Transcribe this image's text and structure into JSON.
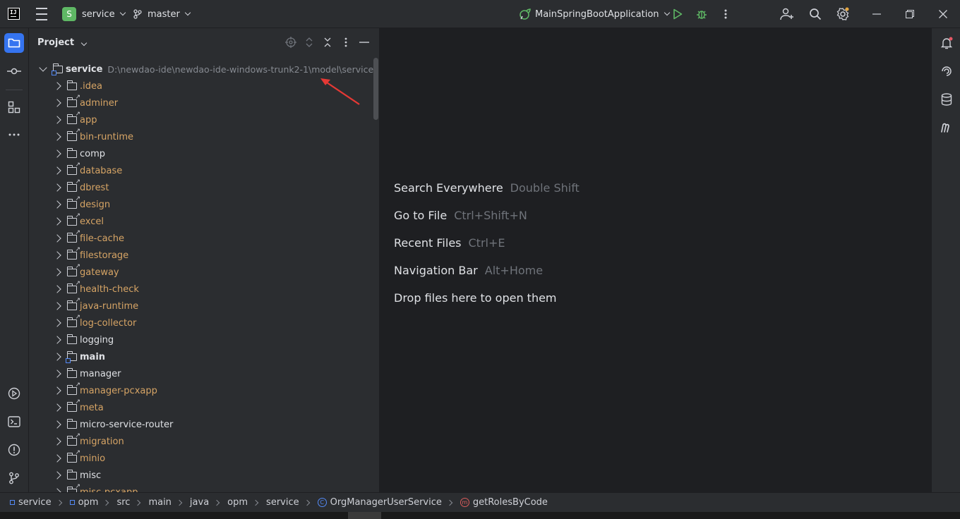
{
  "titlebar": {
    "project_letter": "S",
    "project_name": "service",
    "branch": "master",
    "run_config": "MainSpringBootApplication"
  },
  "project_panel": {
    "title": "Project",
    "root": {
      "name": "service",
      "path": "D:\\newdao-ide\\newdao-ide-windows-trunk2-1\\model\\service"
    },
    "items": [
      {
        "name": ".idea",
        "style": "orange",
        "icon": "folder"
      },
      {
        "name": "adminer",
        "style": "orange",
        "icon": "folder-ext"
      },
      {
        "name": "app",
        "style": "orange",
        "icon": "folder-ext"
      },
      {
        "name": "bin-runtime",
        "style": "orange",
        "icon": "folder-ext"
      },
      {
        "name": "comp",
        "style": "normal",
        "icon": "folder"
      },
      {
        "name": "database",
        "style": "orange",
        "icon": "folder-ext"
      },
      {
        "name": "dbrest",
        "style": "orange",
        "icon": "folder-ext"
      },
      {
        "name": "design",
        "style": "orange",
        "icon": "folder-ext"
      },
      {
        "name": "excel",
        "style": "orange",
        "icon": "folder-ext"
      },
      {
        "name": "file-cache",
        "style": "orange",
        "icon": "folder-ext"
      },
      {
        "name": "filestorage",
        "style": "orange",
        "icon": "folder-ext"
      },
      {
        "name": "gateway",
        "style": "orange",
        "icon": "folder-ext"
      },
      {
        "name": "health-check",
        "style": "orange",
        "icon": "folder-ext"
      },
      {
        "name": "java-runtime",
        "style": "orange",
        "icon": "folder-ext"
      },
      {
        "name": "log-collector",
        "style": "orange",
        "icon": "folder-ext"
      },
      {
        "name": "logging",
        "style": "normal",
        "icon": "folder"
      },
      {
        "name": "main",
        "style": "bold",
        "icon": "folder-module"
      },
      {
        "name": "manager",
        "style": "normal",
        "icon": "folder"
      },
      {
        "name": "manager-pcxapp",
        "style": "orange",
        "icon": "folder-ext"
      },
      {
        "name": "meta",
        "style": "orange",
        "icon": "folder-ext"
      },
      {
        "name": "micro-service-router",
        "style": "normal",
        "icon": "folder"
      },
      {
        "name": "migration",
        "style": "orange",
        "icon": "folder-ext"
      },
      {
        "name": "minio",
        "style": "orange",
        "icon": "folder-ext"
      },
      {
        "name": "misc",
        "style": "normal",
        "icon": "folder"
      },
      {
        "name": "misc-pcxapp",
        "style": "orange",
        "icon": "folder-ext"
      }
    ]
  },
  "editor_hints": [
    {
      "action": "Search Everywhere",
      "shortcut": "Double Shift"
    },
    {
      "action": "Go to File",
      "shortcut": "Ctrl+Shift+N"
    },
    {
      "action": "Recent Files",
      "shortcut": "Ctrl+E"
    },
    {
      "action": "Navigation Bar",
      "shortcut": "Alt+Home"
    },
    {
      "action": "Drop files here to open them",
      "shortcut": ""
    }
  ],
  "statusbar": {
    "breadcrumbs": [
      "service",
      "opm",
      "src",
      "main",
      "java",
      "opm",
      "service",
      "OrgManagerUserService",
      "getRolesByCode"
    ]
  },
  "colors": {
    "accent": "#3574f0",
    "excluded_folder": "#d6a465",
    "annotation_arrow": "#e53935",
    "run": "#5fb865"
  }
}
